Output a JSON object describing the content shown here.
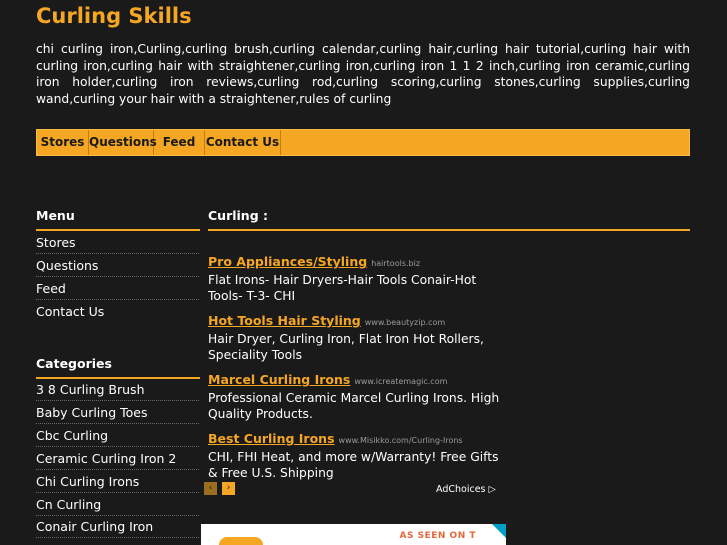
{
  "site": {
    "title": "Curling Skills",
    "tagline": "chi curling iron,Curling,curling brush,curling calendar,curling hair,curling hair tutorial,curling hair with curling iron,curling hair with straightener,curling iron,curling iron 1 1 2 inch,curling iron ceramic,curling iron holder,curling iron reviews,curling rod,curling scoring,curling stones,curling supplies,curling wand,curling your hair with a straightener,rules of curling"
  },
  "nav": {
    "stores": "Stores",
    "questions": "Questions",
    "feed": "Feed",
    "contact": "Contact Us"
  },
  "sidebar": {
    "menu_heading": "Menu",
    "menu_items": [
      "Stores",
      "Questions",
      "Feed",
      "Contact Us"
    ],
    "categories_heading": "Categories",
    "categories": [
      "3 8 Curling Brush",
      "Baby Curling Toes",
      "Cbc Curling",
      "Ceramic Curling Iron 2",
      "Chi Curling Irons",
      "Cn Curling",
      "Conair Curling Iron"
    ]
  },
  "main": {
    "heading": "Curling :"
  },
  "ads": [
    {
      "title": "Pro Appliances/Styling",
      "url": "hairtools.biz",
      "desc": "Flat Irons- Hair Dryers-Hair Tools Conair-Hot Tools- T-3- CHI"
    },
    {
      "title": "Hot Tools Hair Styling",
      "url": "www.beautyzip.com",
      "desc": "Hair Dryer, Curling Iron, Flat Iron Hot Rollers, Speciality Tools"
    },
    {
      "title": "Marcel Curling Irons",
      "url": "www.icreatemagic.com",
      "desc": "Professional Ceramic Marcel Curling Irons. High Quality Products."
    },
    {
      "title": "Best Curling Irons",
      "url": "www.Misikko.com/Curling-Irons",
      "desc": "CHI, FHI Heat, and more w/Warranty! Free Gifts & Free U.S. Shipping"
    }
  ],
  "adchoices": {
    "label": "AdChoices",
    "prev_icon": "‹",
    "next_icon": "›",
    "choices_icon": "▷"
  },
  "banner": {
    "text": "AS SEEN ON T"
  },
  "colors": {
    "accent": "#f5a623",
    "background": "#1a1a1a",
    "text": "#ffffff"
  }
}
